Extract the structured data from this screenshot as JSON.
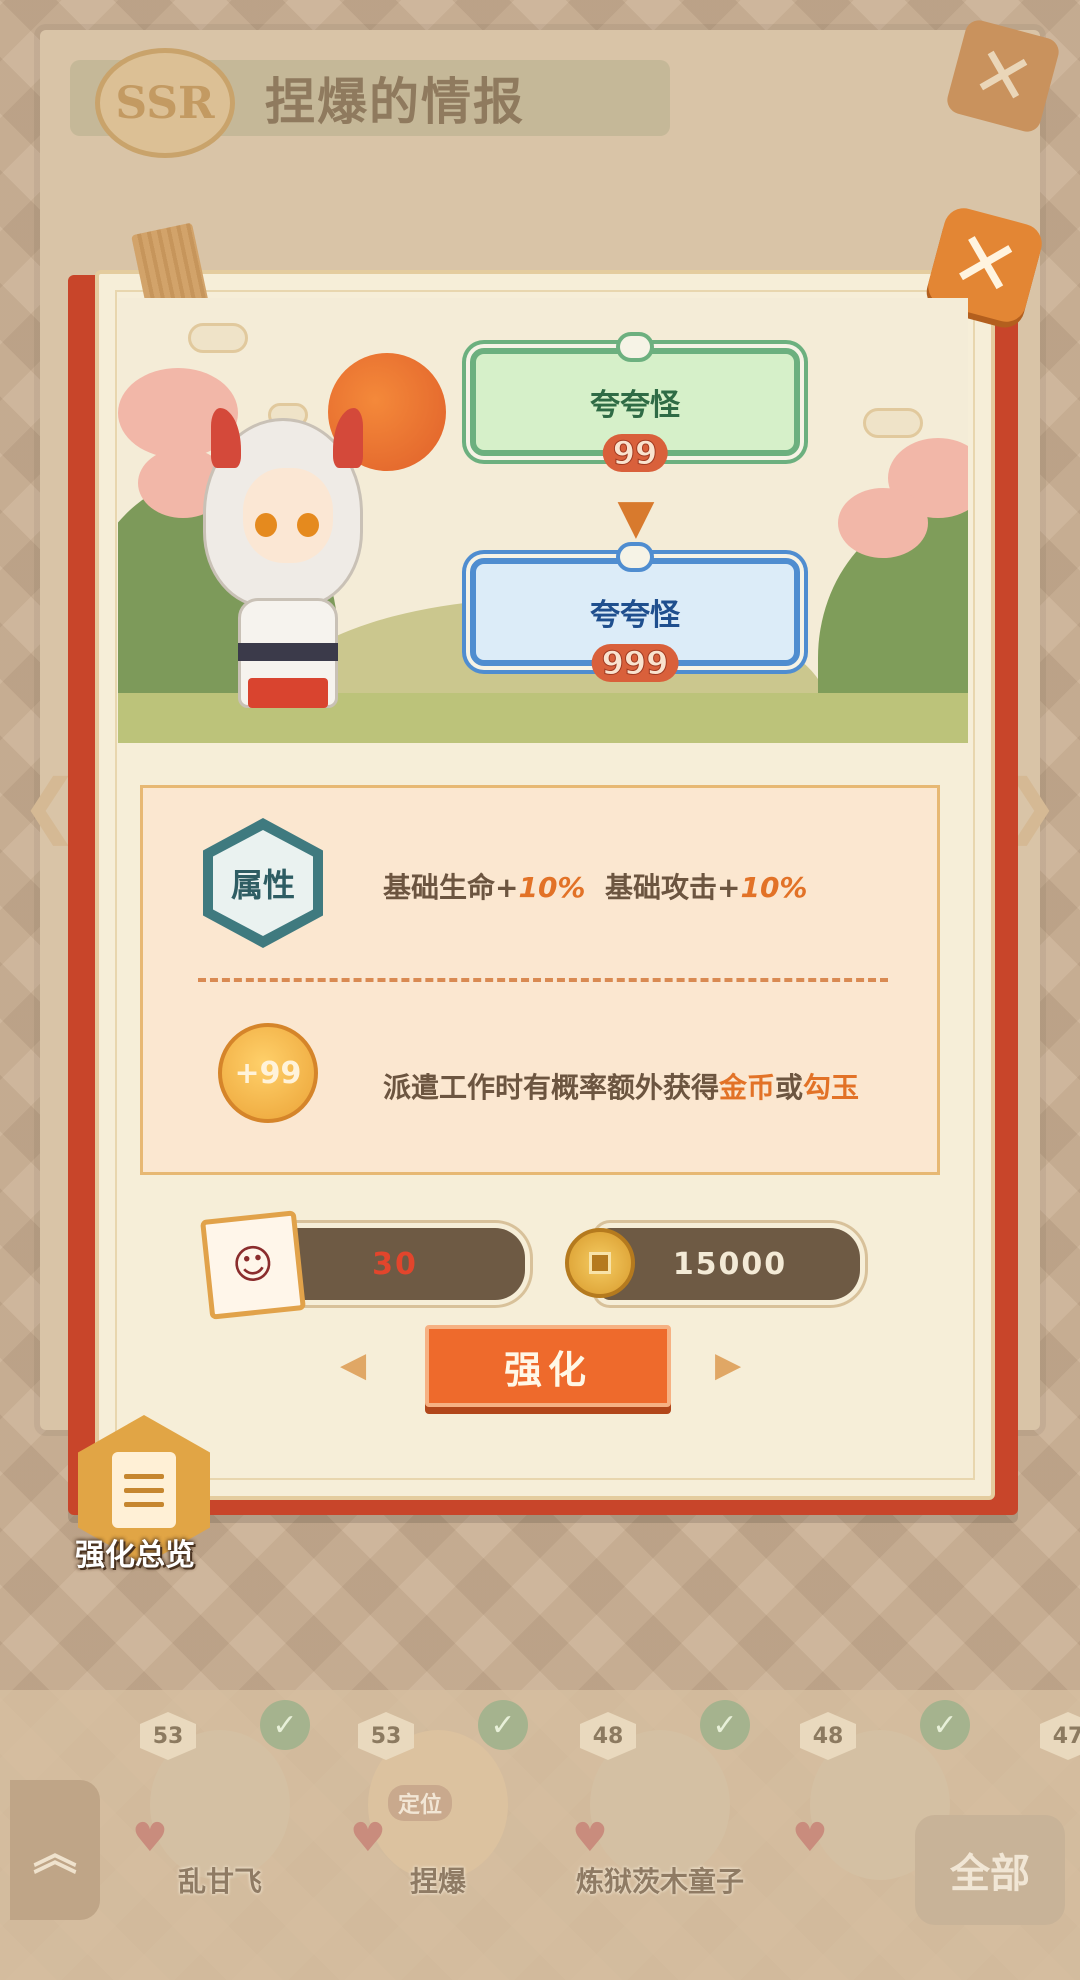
{
  "header": {
    "rarity_badge": "SSR",
    "title": "捏爆的情报"
  },
  "enhance_panel": {
    "from_title": {
      "name": "夸夸怪",
      "level": "99"
    },
    "to_title": {
      "name": "夸夸怪",
      "level": "999"
    },
    "attribute_badge": "属性",
    "attribute_text_prefix": "基础生命+",
    "attribute_hp_bonus": "10%",
    "attribute_text_mid": "基础攻击+",
    "attribute_atk_bonus": "10%",
    "coin_badge_text": "+99",
    "dispatch_text_prefix": "派遣工作时有概率额外获得",
    "dispatch_reward_gold": "金币",
    "dispatch_text_or": "或",
    "dispatch_reward_jade": "勾玉",
    "cost_shard": "30",
    "cost_coin": "15000",
    "enhance_button": "强化"
  },
  "overview_button": {
    "label": "强化总览"
  },
  "roster": {
    "items": [
      {
        "level": "53",
        "name": "乱甘飞",
        "checked": true
      },
      {
        "level": "53",
        "name": "捏爆",
        "checked": true,
        "tag": "定位"
      },
      {
        "level": "48",
        "name": "炼狱茨木童子",
        "checked": true
      },
      {
        "level": "48",
        "name": "",
        "checked": true
      },
      {
        "level": "47",
        "name": "",
        "checked": false
      }
    ],
    "all_button": "全部"
  },
  "colors": {
    "accent_orange": "#ee6a2c",
    "card_red": "#c8452a",
    "title_green": "#6cb07f",
    "title_blue": "#4f8dd0"
  }
}
